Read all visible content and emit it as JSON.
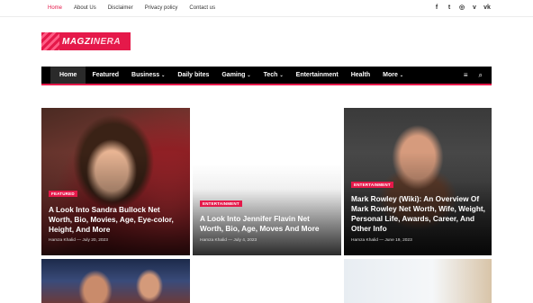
{
  "top_nav": {
    "items": [
      "Home",
      "About Us",
      "Disclaimer",
      "Privacy policy",
      "Contact us"
    ]
  },
  "social": {
    "icons": [
      "facebook-icon",
      "twitter-icon",
      "instagram-icon",
      "vk-icon",
      "vk-icon"
    ],
    "glyphs": [
      "f",
      "t",
      "◎",
      "v",
      "vk"
    ]
  },
  "logo": {
    "part1": "MAGZI",
    "part2": "NERA"
  },
  "main_nav": {
    "items": [
      {
        "label": "Home",
        "dropdown": false
      },
      {
        "label": "Featured",
        "dropdown": false
      },
      {
        "label": "Business",
        "dropdown": true
      },
      {
        "label": "Daily bites",
        "dropdown": false
      },
      {
        "label": "Gaming",
        "dropdown": true
      },
      {
        "label": "Tech",
        "dropdown": true
      },
      {
        "label": "Entertainment",
        "dropdown": false
      },
      {
        "label": "Health",
        "dropdown": false
      },
      {
        "label": "More",
        "dropdown": true
      }
    ],
    "chevron": "⌄",
    "menu_icon": "≡",
    "search_icon": "⌕"
  },
  "cards": [
    {
      "badge": "FEATURED",
      "title": "A Look Into Sandra Bullock Net Worth, Bio, Movies, Age, Eye-color, Height, And More",
      "author": "Hamza Khalid",
      "sep": "—",
      "date": "July 20, 2023"
    },
    {
      "badge": "ENTERTAINMENT",
      "title": "A Look Into Jennifer Flavin Net Worth, Bio, Age, Moves And More",
      "author": "Hamza Khalid",
      "sep": "—",
      "date": "July 4, 2023"
    },
    {
      "badge": "ENTERTAINMENT",
      "title": "Mark Rowley (Wiki): An Overview Of Mark Rowley Net Worth, Wife, Weight, Personal Life, Awards, Career, And Other Info",
      "author": "Hamza Khalid",
      "sep": "—",
      "date": "June 19, 2023"
    }
  ],
  "colors": {
    "accent": "#e5194a",
    "nav_bg": "#000000"
  }
}
